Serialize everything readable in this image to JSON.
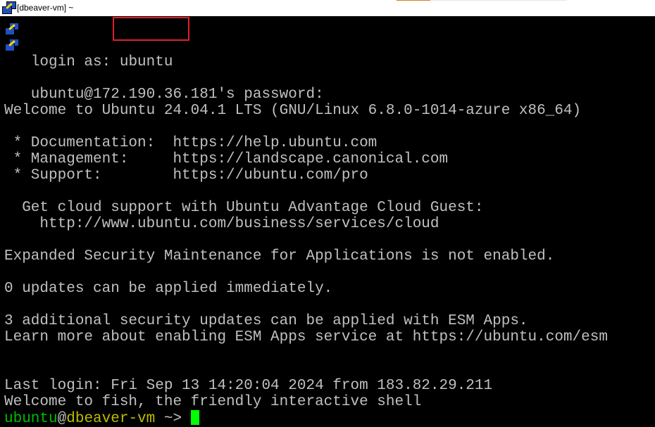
{
  "window": {
    "title": "[dbeaver-vm] ~",
    "icon": "putty-icon"
  },
  "terminal": {
    "login_prompt": "login as: ",
    "login_user": "ubuntu",
    "lines": [
      "ubuntu@172.190.36.181's password:",
      "Welcome to Ubuntu 24.04.1 LTS (GNU/Linux 6.8.0-1014-azure x86_64)",
      "",
      " * Documentation:  https://help.ubuntu.com",
      " * Management:     https://landscape.canonical.com",
      " * Support:        https://ubuntu.com/pro",
      "",
      "  Get cloud support with Ubuntu Advantage Cloud Guest:",
      "    http://www.ubuntu.com/business/services/cloud",
      "",
      "Expanded Security Maintenance for Applications is not enabled.",
      "",
      "0 updates can be applied immediately.",
      "",
      "3 additional security updates can be applied with ESM Apps.",
      "Learn more about enabling ESM Apps service at https://ubuntu.com/esm",
      "",
      "",
      "Last login: Fri Sep 13 14:20:04 2024 from 183.82.29.211",
      "Welcome to fish, the friendly interactive shell"
    ],
    "prompt": {
      "user": "ubuntu",
      "at": "@",
      "host": "dbeaver-vm",
      "suffix": " ~> "
    },
    "colors": {
      "text": "#c0c0c0",
      "user": "#00bb00",
      "host": "#bbbb00",
      "cursor": "#00ff00",
      "highlight": "#e0202a"
    }
  }
}
